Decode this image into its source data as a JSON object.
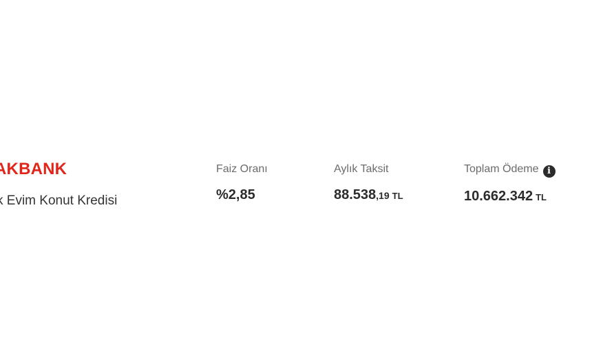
{
  "bank": {
    "logo_text": "AKBANK",
    "brand_color": "#e1251b",
    "product_name": "k Evim Konut Kredisi"
  },
  "metrics": {
    "interest": {
      "label": "Faiz Oranı",
      "value": "%2,85"
    },
    "monthly": {
      "label": "Aylık Taksit",
      "value_main": "88.538",
      "value_cents": ",19",
      "currency": "TL"
    },
    "total": {
      "label": "Toplam Ödeme",
      "value": "10.662.342",
      "currency": "TL",
      "info_icon": "info-icon"
    }
  }
}
